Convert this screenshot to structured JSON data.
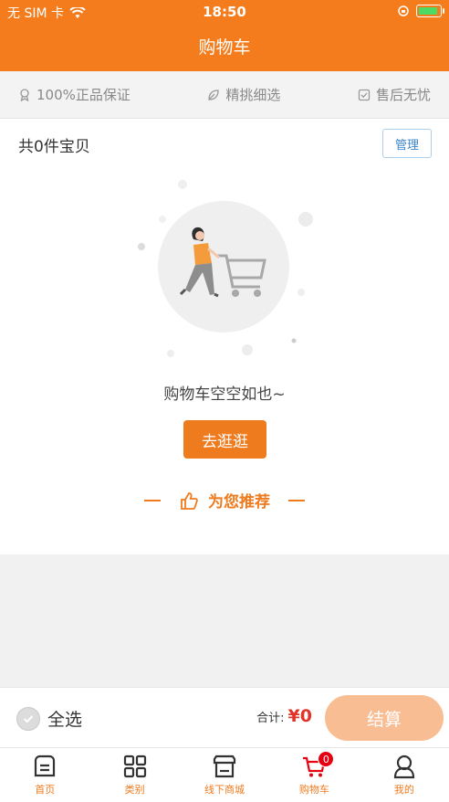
{
  "status_bar": {
    "carrier": "无 SIM 卡",
    "time": "18:50"
  },
  "header": {
    "title": "购物车"
  },
  "guarantees": [
    {
      "label": "100%正品保证",
      "icon": "award-icon"
    },
    {
      "label": "精挑细选",
      "icon": "leaf-icon"
    },
    {
      "label": "售后无忧",
      "icon": "check-square-icon"
    }
  ],
  "cart": {
    "count_label": "共0件宝贝",
    "manage_label": "管理",
    "empty_text": "购物车空空如也~",
    "go_shopping_label": "去逛逛",
    "recommend_label": "为您推荐"
  },
  "bottom_bar": {
    "select_all_label": "全选",
    "total_label": "合计:",
    "total_amount": "¥0",
    "checkout_label": "结算"
  },
  "tab_bar": {
    "items": [
      {
        "label": "首页",
        "icon": "home-icon"
      },
      {
        "label": "类别",
        "icon": "grid-icon"
      },
      {
        "label": "线下商城",
        "icon": "store-icon"
      },
      {
        "label": "购物车",
        "icon": "cart-icon",
        "badge": "0"
      },
      {
        "label": "我的",
        "icon": "user-icon"
      }
    ]
  },
  "colors": {
    "brand": "#f47c1c",
    "price": "#e0342a",
    "checkout_disabled": "#f9bd94"
  }
}
